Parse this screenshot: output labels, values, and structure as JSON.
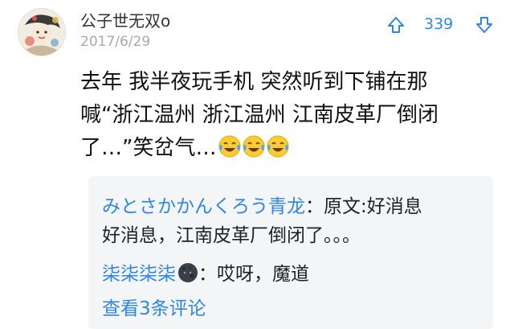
{
  "comment": {
    "username": "公子世无双o",
    "date": "2017/6/29",
    "votes": "339",
    "lines": [
      "去年  我半夜玩手机  突然听到下铺在那",
      "喊“浙江温州 浙江温州 江南皮革厂倒闭",
      "了…”笑岔气…"
    ],
    "emoji_icons": [
      "tears-of-joy-icon",
      "tears-of-joy-icon",
      "tears-of-joy-icon"
    ]
  },
  "replies": [
    {
      "name": "みとさかかんくろう青龙",
      "separator": "：",
      "text_lines": [
        "原文:好消息",
        "好消息，江南皮革厂倒闭了。。。"
      ]
    },
    {
      "name": "柒柒柒柒",
      "separator": "：",
      "text_lines": [
        "哎呀，魔道"
      ],
      "emoji_icon": "new-moon-face-icon"
    }
  ],
  "more_replies_label": "查看3条评论",
  "colors": {
    "accent": "#2f86e6",
    "reply_bg": "#f4f5f7",
    "date": "#a9a9a9"
  }
}
